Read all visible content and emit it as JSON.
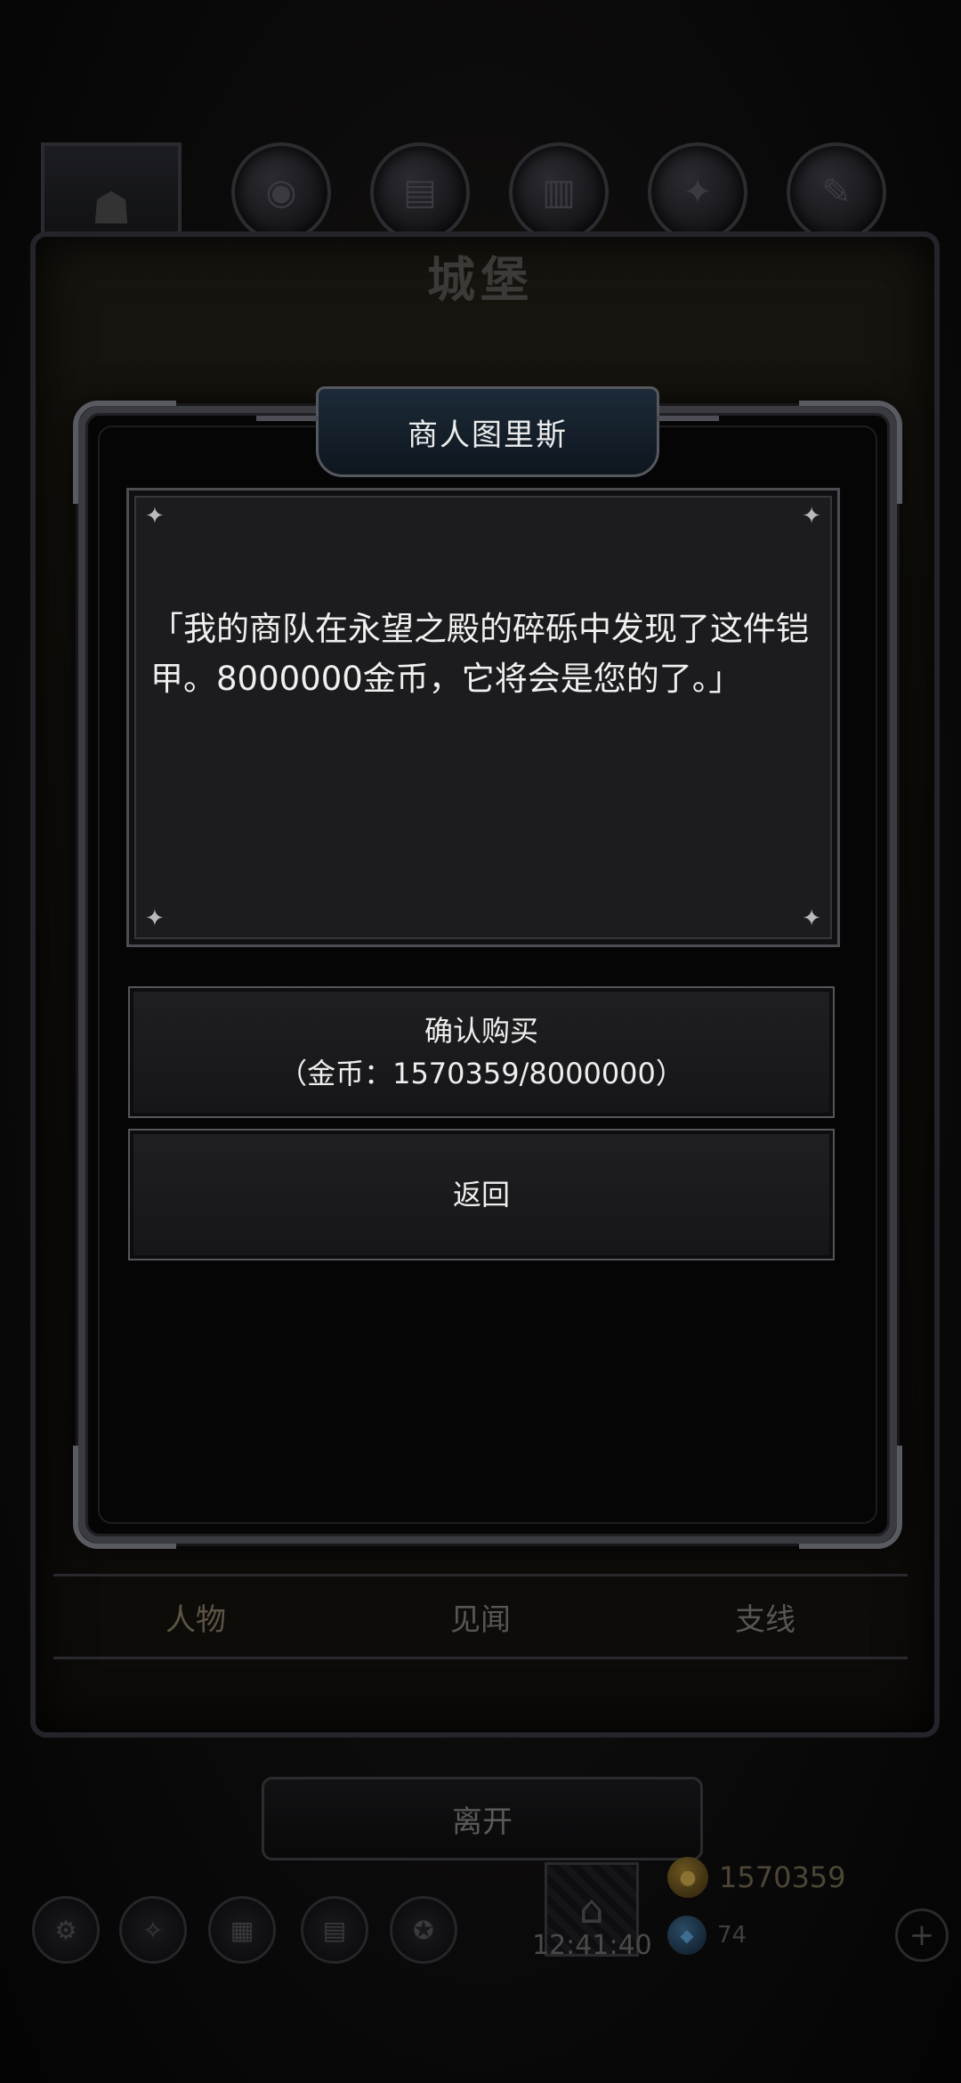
{
  "background": {
    "castle_title": "城堡",
    "top_icons": [
      "character-portrait",
      "orb-icon",
      "scroll-icon",
      "book-icon",
      "feather-icon",
      "quill-icon"
    ],
    "tabs": [
      {
        "label": "人物",
        "active": true
      },
      {
        "label": "见闻",
        "active": false
      },
      {
        "label": "支线",
        "active": false
      }
    ],
    "leave_label": "离开",
    "clock": "12:41:40",
    "gold": "1570359",
    "gems": "74"
  },
  "dialog": {
    "title": "商人图里斯",
    "message": "「我的商队在永望之殿的碎砾中发现了这件铠甲。8000000金币，它将会是您的了。」",
    "confirm_label": "确认购买",
    "confirm_cost": "（金币：1570359/8000000）",
    "back_label": "返回"
  },
  "colors": {
    "accent_gold": "#8a7230",
    "frame": "#3a3b40",
    "text": "#f0f0f0"
  }
}
